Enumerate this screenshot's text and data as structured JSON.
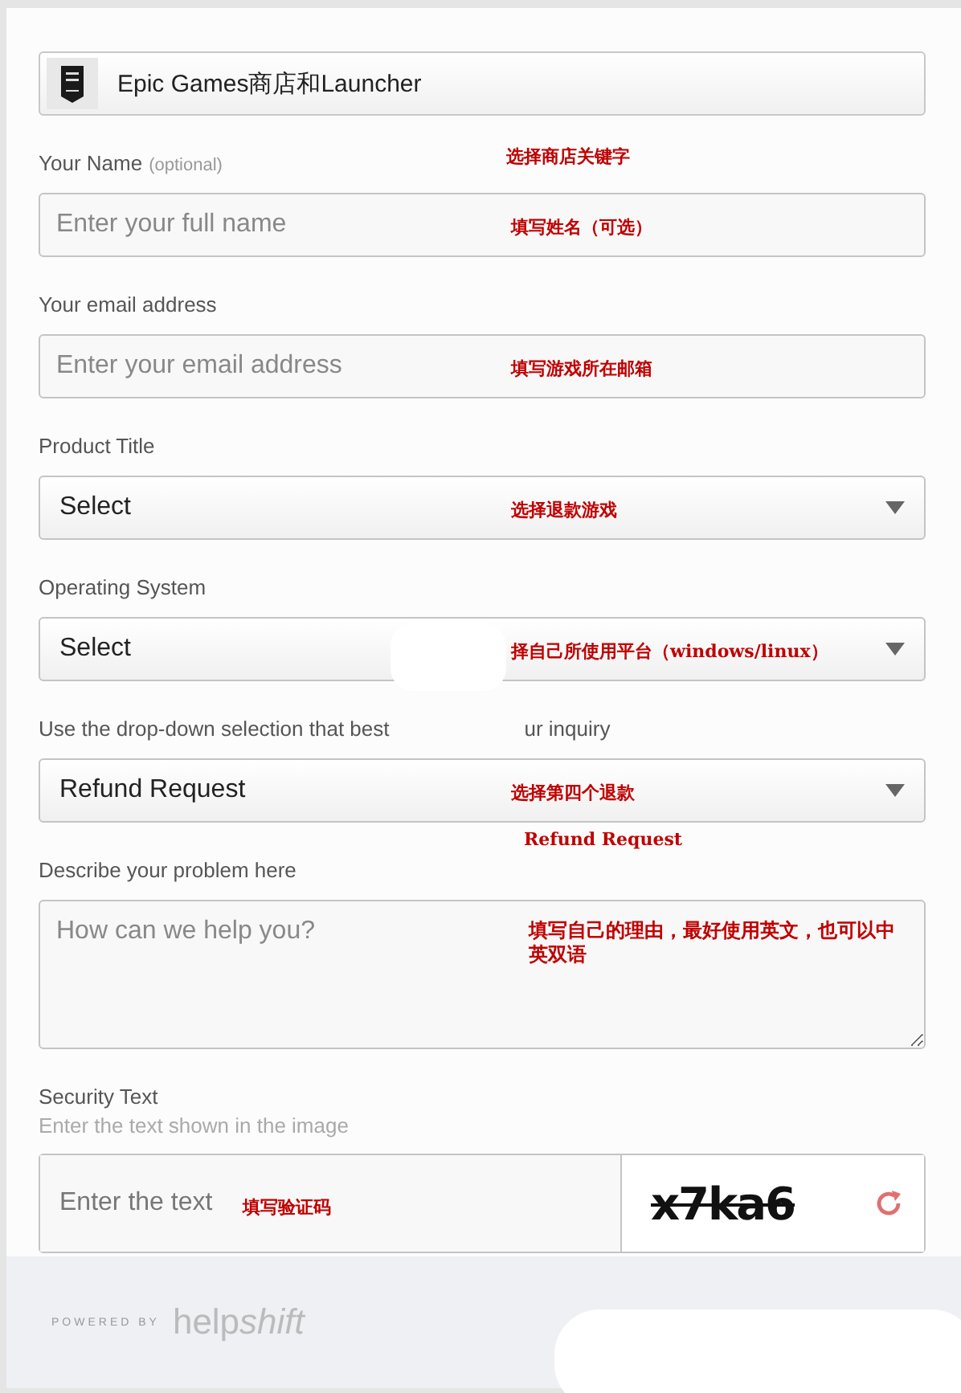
{
  "store": {
    "name": "Epic Games商店和Launcher",
    "annotation": "选择商店关键字"
  },
  "groups": [
    {
      "kind": "text",
      "label": "Your Name",
      "note": "(optional)",
      "placeholder": "Enter your full name",
      "annotations": [
        {
          "kind": "inside",
          "text": "填写姓名（可选）"
        }
      ]
    },
    {
      "kind": "text",
      "label": "Your email address",
      "placeholder": "Enter your email address",
      "annotations": [
        {
          "kind": "inside",
          "text": "填写游戏所在邮箱"
        }
      ]
    },
    {
      "kind": "select",
      "label": "Product Title",
      "value": "Select",
      "annotations": [
        {
          "kind": "inside",
          "text": "选择退款游戏"
        }
      ]
    },
    {
      "kind": "select",
      "label": "Operating System",
      "value": "Select",
      "annotations": [
        {
          "kind": "inside",
          "text": "择自己所使用平台（windows/linux）"
        }
      ]
    },
    {
      "kind": "select",
      "label": "Use the drop-down selection that best",
      "label_tail": "ur inquiry",
      "value": "Refund Request",
      "annotations": [
        {
          "kind": "inside",
          "text": "选择第四个退款"
        },
        {
          "kind": "below",
          "text": "Refund Request"
        }
      ]
    },
    {
      "kind": "textarea",
      "label": "Describe your problem here",
      "placeholder": "How can we help you?",
      "annotations": [
        {
          "kind": "wrap",
          "text": "填写自己的理由，最好使用英文，也可以中英双语"
        }
      ]
    }
  ],
  "security": {
    "label": "Security Text",
    "hint": "Enter the text shown in the image",
    "placeholder": "Enter the text",
    "annotation": "填写验证码",
    "captcha": "x7ka6"
  },
  "footer": {
    "powered": "POWERED BY",
    "brand": [
      "help",
      "shift"
    ]
  }
}
